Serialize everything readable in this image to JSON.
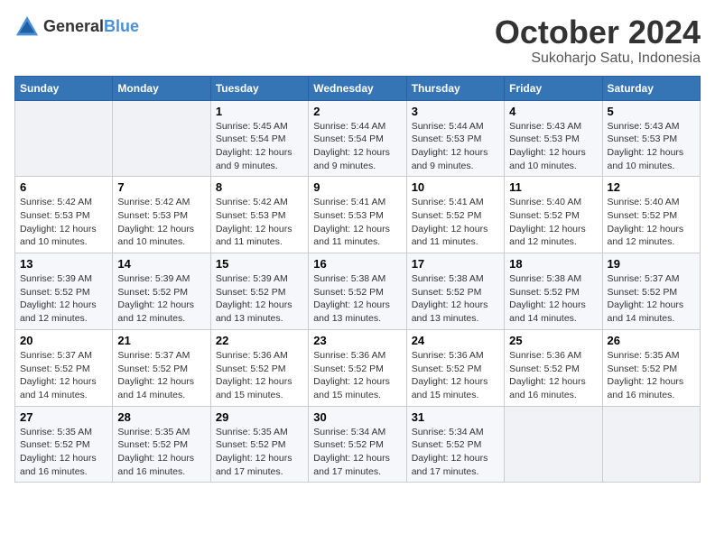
{
  "header": {
    "logo_general": "General",
    "logo_blue": "Blue",
    "month_title": "October 2024",
    "subtitle": "Sukoharjo Satu, Indonesia"
  },
  "weekdays": [
    "Sunday",
    "Monday",
    "Tuesday",
    "Wednesday",
    "Thursday",
    "Friday",
    "Saturday"
  ],
  "weeks": [
    [
      {
        "day": "",
        "info": ""
      },
      {
        "day": "",
        "info": ""
      },
      {
        "day": "1",
        "info": "Sunrise: 5:45 AM\nSunset: 5:54 PM\nDaylight: 12 hours and 9 minutes."
      },
      {
        "day": "2",
        "info": "Sunrise: 5:44 AM\nSunset: 5:54 PM\nDaylight: 12 hours and 9 minutes."
      },
      {
        "day": "3",
        "info": "Sunrise: 5:44 AM\nSunset: 5:53 PM\nDaylight: 12 hours and 9 minutes."
      },
      {
        "day": "4",
        "info": "Sunrise: 5:43 AM\nSunset: 5:53 PM\nDaylight: 12 hours and 10 minutes."
      },
      {
        "day": "5",
        "info": "Sunrise: 5:43 AM\nSunset: 5:53 PM\nDaylight: 12 hours and 10 minutes."
      }
    ],
    [
      {
        "day": "6",
        "info": "Sunrise: 5:42 AM\nSunset: 5:53 PM\nDaylight: 12 hours and 10 minutes."
      },
      {
        "day": "7",
        "info": "Sunrise: 5:42 AM\nSunset: 5:53 PM\nDaylight: 12 hours and 10 minutes."
      },
      {
        "day": "8",
        "info": "Sunrise: 5:42 AM\nSunset: 5:53 PM\nDaylight: 12 hours and 11 minutes."
      },
      {
        "day": "9",
        "info": "Sunrise: 5:41 AM\nSunset: 5:53 PM\nDaylight: 12 hours and 11 minutes."
      },
      {
        "day": "10",
        "info": "Sunrise: 5:41 AM\nSunset: 5:52 PM\nDaylight: 12 hours and 11 minutes."
      },
      {
        "day": "11",
        "info": "Sunrise: 5:40 AM\nSunset: 5:52 PM\nDaylight: 12 hours and 12 minutes."
      },
      {
        "day": "12",
        "info": "Sunrise: 5:40 AM\nSunset: 5:52 PM\nDaylight: 12 hours and 12 minutes."
      }
    ],
    [
      {
        "day": "13",
        "info": "Sunrise: 5:39 AM\nSunset: 5:52 PM\nDaylight: 12 hours and 12 minutes."
      },
      {
        "day": "14",
        "info": "Sunrise: 5:39 AM\nSunset: 5:52 PM\nDaylight: 12 hours and 12 minutes."
      },
      {
        "day": "15",
        "info": "Sunrise: 5:39 AM\nSunset: 5:52 PM\nDaylight: 12 hours and 13 minutes."
      },
      {
        "day": "16",
        "info": "Sunrise: 5:38 AM\nSunset: 5:52 PM\nDaylight: 12 hours and 13 minutes."
      },
      {
        "day": "17",
        "info": "Sunrise: 5:38 AM\nSunset: 5:52 PM\nDaylight: 12 hours and 13 minutes."
      },
      {
        "day": "18",
        "info": "Sunrise: 5:38 AM\nSunset: 5:52 PM\nDaylight: 12 hours and 14 minutes."
      },
      {
        "day": "19",
        "info": "Sunrise: 5:37 AM\nSunset: 5:52 PM\nDaylight: 12 hours and 14 minutes."
      }
    ],
    [
      {
        "day": "20",
        "info": "Sunrise: 5:37 AM\nSunset: 5:52 PM\nDaylight: 12 hours and 14 minutes."
      },
      {
        "day": "21",
        "info": "Sunrise: 5:37 AM\nSunset: 5:52 PM\nDaylight: 12 hours and 14 minutes."
      },
      {
        "day": "22",
        "info": "Sunrise: 5:36 AM\nSunset: 5:52 PM\nDaylight: 12 hours and 15 minutes."
      },
      {
        "day": "23",
        "info": "Sunrise: 5:36 AM\nSunset: 5:52 PM\nDaylight: 12 hours and 15 minutes."
      },
      {
        "day": "24",
        "info": "Sunrise: 5:36 AM\nSunset: 5:52 PM\nDaylight: 12 hours and 15 minutes."
      },
      {
        "day": "25",
        "info": "Sunrise: 5:36 AM\nSunset: 5:52 PM\nDaylight: 12 hours and 16 minutes."
      },
      {
        "day": "26",
        "info": "Sunrise: 5:35 AM\nSunset: 5:52 PM\nDaylight: 12 hours and 16 minutes."
      }
    ],
    [
      {
        "day": "27",
        "info": "Sunrise: 5:35 AM\nSunset: 5:52 PM\nDaylight: 12 hours and 16 minutes."
      },
      {
        "day": "28",
        "info": "Sunrise: 5:35 AM\nSunset: 5:52 PM\nDaylight: 12 hours and 16 minutes."
      },
      {
        "day": "29",
        "info": "Sunrise: 5:35 AM\nSunset: 5:52 PM\nDaylight: 12 hours and 17 minutes."
      },
      {
        "day": "30",
        "info": "Sunrise: 5:34 AM\nSunset: 5:52 PM\nDaylight: 12 hours and 17 minutes."
      },
      {
        "day": "31",
        "info": "Sunrise: 5:34 AM\nSunset: 5:52 PM\nDaylight: 12 hours and 17 minutes."
      },
      {
        "day": "",
        "info": ""
      },
      {
        "day": "",
        "info": ""
      }
    ]
  ]
}
